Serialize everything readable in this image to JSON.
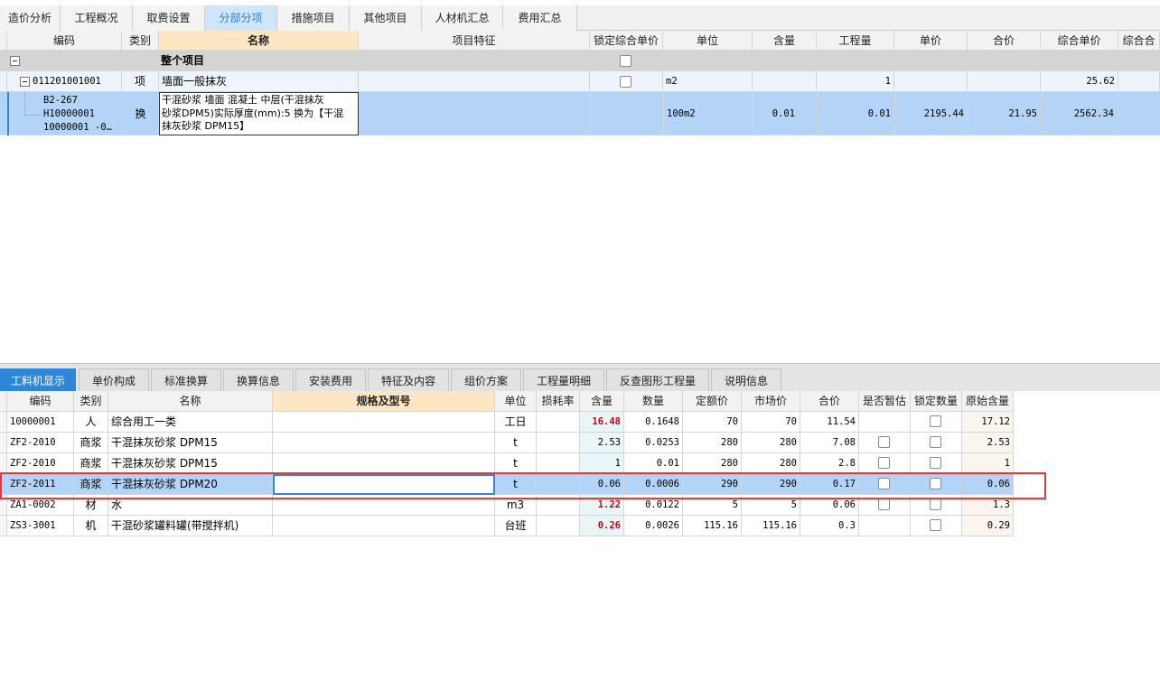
{
  "top_tabs": [
    {
      "label": "造价分析"
    },
    {
      "label": "工程概况"
    },
    {
      "label": "取费设置"
    },
    {
      "label": "分部分项"
    },
    {
      "label": "措施项目"
    },
    {
      "label": "其他项目"
    },
    {
      "label": "人材机汇总"
    },
    {
      "label": "费用汇总"
    }
  ],
  "top_grid": {
    "headers": [
      "编码",
      "类别",
      "名称",
      "项目特征",
      "锁定综合单价",
      "单位",
      "含量",
      "工程量",
      "单价",
      "合价",
      "综合单价",
      "综合合"
    ],
    "whole_project": {
      "label": "整个项目"
    },
    "item_row": {
      "code": "011201001001",
      "type": "项",
      "name": "墙面一般抹灰",
      "unit": "m2",
      "quantity": "1",
      "composite_price": "25.62"
    },
    "sub_row": {
      "code_line1": "B2-267",
      "code_line2": "H10000001",
      "code_line3": "10000001 -0…",
      "type": "换",
      "name_line1": "干混砂浆 墙面 混凝土  中层(干混抹灰",
      "name_line2": "砂浆DPM5)实际厚度(mm):5  换为【干混",
      "name_line3": "抹灰砂浆 DPM15】",
      "unit": "100m2",
      "content": "0.01",
      "quantity": "0.01",
      "unit_price": "2195.44",
      "total": "21.95",
      "composite_price": "2562.34"
    }
  },
  "bottom_tabs": [
    {
      "label": "工料机显示"
    },
    {
      "label": "单价构成"
    },
    {
      "label": "标准换算"
    },
    {
      "label": "换算信息"
    },
    {
      "label": "安装费用"
    },
    {
      "label": "特征及内容"
    },
    {
      "label": "组价方案"
    },
    {
      "label": "工程量明细"
    },
    {
      "label": "反查图形工程量"
    },
    {
      "label": "说明信息"
    }
  ],
  "bottom_grid": {
    "headers": [
      "编码",
      "类别",
      "名称",
      "规格及型号",
      "单位",
      "损耗率",
      "含量",
      "数量",
      "定额价",
      "市场价",
      "合价",
      "是否暂估",
      "锁定数量",
      "原始含量"
    ],
    "rows": [
      {
        "code": "10000001",
        "type": "人",
        "name": "综合用工一类",
        "spec": "",
        "unit": "工日",
        "loss": "",
        "content": "16.48",
        "qty": "0.1648",
        "quota_price": "70",
        "market_price": "70",
        "total": "11.54",
        "orig": "17.12"
      },
      {
        "code": "ZF2-2010",
        "type": "商浆",
        "name": "干混抹灰砂浆 DPM15",
        "spec": "",
        "unit": "t",
        "loss": "",
        "content": "2.53",
        "qty": "0.0253",
        "quota_price": "280",
        "market_price": "280",
        "total": "7.08",
        "orig": "2.53"
      },
      {
        "code": "ZF2-2010",
        "type": "商浆",
        "name": "干混抹灰砂浆 DPM15",
        "spec": "",
        "unit": "t",
        "loss": "",
        "content": "1",
        "qty": "0.01",
        "quota_price": "280",
        "market_price": "280",
        "total": "2.8",
        "orig": "1"
      },
      {
        "code": "ZF2-2011",
        "type": "商浆",
        "name": "干混抹灰砂浆 DPM20",
        "spec": "",
        "unit": "t",
        "loss": "",
        "content": "0.06",
        "qty": "0.0006",
        "quota_price": "290",
        "market_price": "290",
        "total": "0.17",
        "orig": "0.06"
      },
      {
        "code": "ZA1-0002",
        "type": "材",
        "name": "水",
        "spec": "",
        "unit": "m3",
        "loss": "",
        "content": "1.22",
        "qty": "0.0122",
        "quota_price": "5",
        "market_price": "5",
        "total": "0.06",
        "orig": "1.3"
      },
      {
        "code": "ZS3-3001",
        "type": "机",
        "name": "干混砂浆罐料罐(带搅拌机)",
        "spec": "",
        "unit": "台班",
        "loss": "",
        "content": "0.26",
        "qty": "0.0026",
        "quota_price": "115.16",
        "market_price": "115.16",
        "total": "0.3",
        "orig": "0.29"
      }
    ]
  },
  "colors": {
    "accent": "#2f86d6",
    "selected_row": "#b3d4f7",
    "highlight_value": "#d0021b",
    "header_selected": "#fde6c4",
    "red_frame": "#e23a3a"
  }
}
